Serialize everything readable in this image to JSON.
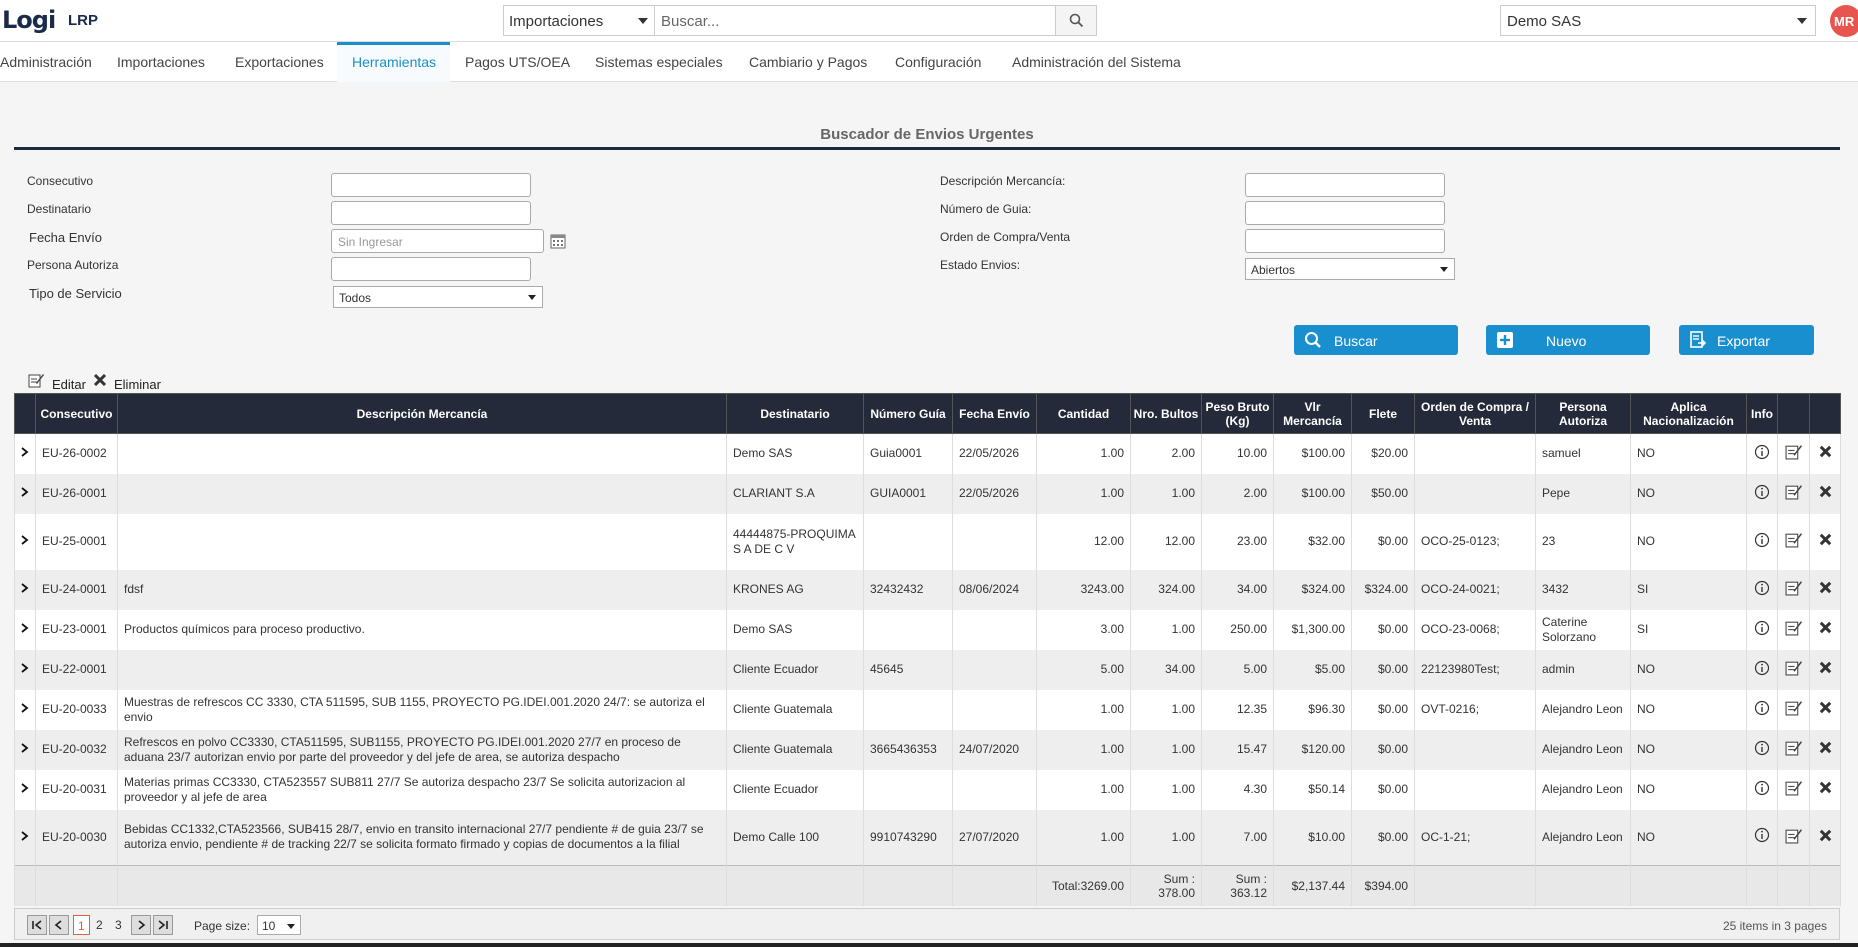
{
  "header": {
    "logo": "Logi",
    "logo_suffix": "LRP",
    "module_select": "Importaciones",
    "search_placeholder": "Buscar...",
    "company_select": "Demo SAS",
    "avatar_initials": "MR"
  },
  "nav": {
    "items": [
      {
        "label": "Administración"
      },
      {
        "label": "Importaciones"
      },
      {
        "label": "Exportaciones"
      },
      {
        "label": "Herramientas",
        "active": true
      },
      {
        "label": "Pagos UTS/OEA"
      },
      {
        "label": "Sistemas especiales"
      },
      {
        "label": "Cambiario y Pagos"
      },
      {
        "label": "Configuración"
      },
      {
        "label": "Administración del Sistema"
      }
    ]
  },
  "panel": {
    "title": "Buscador de Envios Urgentes"
  },
  "form": {
    "consecutivo": "Consecutivo",
    "destinatario": "Destinatario",
    "fecha_envio": "Fecha Envío",
    "fecha_placeholder": "Sin Ingresar",
    "persona_autoriza": "Persona Autoriza",
    "tipo_servicio": "Tipo de Servicio",
    "tipo_servicio_value": "Todos",
    "descripcion": "Descripción Mercancía:",
    "numero_guia": "Número de Guia:",
    "orden_compra": "Orden de Compra/Venta",
    "estado_envios": "Estado Envios:",
    "estado_value": "Abiertos"
  },
  "buttons": {
    "buscar": "Buscar",
    "nuevo": "Nuevo",
    "exportar": "Exportar"
  },
  "toolbar": {
    "editar": "Editar",
    "eliminar": "Eliminar"
  },
  "grid": {
    "columns": [
      "Consecutivo",
      "Descripción Mercancía",
      "Destinatario",
      "Número Guía",
      "Fecha Envío",
      "Cantidad",
      "Nro. Bultos",
      "Peso Bruto (Kg)",
      "Vlr Mercancía",
      "Flete",
      "Orden de Compra / Venta",
      "Persona Autoriza",
      "Aplica Nacionalización",
      "Info"
    ],
    "rows": [
      {
        "consecutivo": "EU-26-0002",
        "descripcion": "",
        "destinatario": "Demo SAS",
        "guia": "Guia0001",
        "fecha": "22/05/2026",
        "cantidad": "1.00",
        "bultos": "2.00",
        "peso": "10.00",
        "valor": "$100.00",
        "flete": "$20.00",
        "orden": "",
        "persona": "samuel",
        "aplica": "NO"
      },
      {
        "consecutivo": "EU-26-0001",
        "descripcion": "",
        "destinatario": "CLARIANT S.A",
        "guia": "GUIA0001",
        "fecha": "22/05/2026",
        "cantidad": "1.00",
        "bultos": "1.00",
        "peso": "2.00",
        "valor": "$100.00",
        "flete": "$50.00",
        "orden": "",
        "persona": "Pepe",
        "aplica": "NO"
      },
      {
        "consecutivo": "EU-25-0001",
        "descripcion": "",
        "destinatario": "44444875-PROQUIMA S A DE C V",
        "guia": "",
        "fecha": "",
        "cantidad": "12.00",
        "bultos": "12.00",
        "peso": "23.00",
        "valor": "$32.00",
        "flete": "$0.00",
        "orden": "OCO-25-0123;",
        "persona": "23",
        "aplica": "NO"
      },
      {
        "consecutivo": "EU-24-0001",
        "descripcion": "fdsf",
        "destinatario": "KRONES AG",
        "guia": "32432432",
        "fecha": "08/06/2024",
        "cantidad": "3243.00",
        "bultos": "324.00",
        "peso": "34.00",
        "valor": "$324.00",
        "flete": "$324.00",
        "orden": "OCO-24-0021;",
        "persona": "3432",
        "aplica": "SI"
      },
      {
        "consecutivo": "EU-23-0001",
        "descripcion": "Productos químicos para proceso productivo.",
        "destinatario": "Demo SAS",
        "guia": "",
        "fecha": "",
        "cantidad": "3.00",
        "bultos": "1.00",
        "peso": "250.00",
        "valor": "$1,300.00",
        "flete": "$0.00",
        "orden": "OCO-23-0068;",
        "persona": "Caterine Solorzano",
        "aplica": "SI"
      },
      {
        "consecutivo": "EU-22-0001",
        "descripcion": "",
        "destinatario": "Cliente Ecuador",
        "guia": "45645",
        "fecha": "",
        "cantidad": "5.00",
        "bultos": "34.00",
        "peso": "5.00",
        "valor": "$5.00",
        "flete": "$0.00",
        "orden": "22123980Test;",
        "persona": "admin",
        "aplica": "NO"
      },
      {
        "consecutivo": "EU-20-0033",
        "descripcion": "Muestras de refrescos CC 3330, CTA 511595, SUB 1155, PROYECTO PG.IDEI.001.2020 24/7: se autoriza el envio",
        "destinatario": "Cliente Guatemala",
        "guia": "",
        "fecha": "",
        "cantidad": "1.00",
        "bultos": "1.00",
        "peso": "12.35",
        "valor": "$96.30",
        "flete": "$0.00",
        "orden": "OVT-0216;",
        "persona": "Alejandro Leon",
        "aplica": "NO"
      },
      {
        "consecutivo": "EU-20-0032",
        "descripcion": "Refrescos en polvo CC3330, CTA511595, SUB1155, PROYECTO PG.IDEI.001.2020 27/7 en proceso de aduana 23/7 autorizan envio por parte del proveedor y del jefe de area, se autoriza despacho",
        "destinatario": "Cliente Guatemala",
        "guia": "3665436353",
        "fecha": "24/07/2020",
        "cantidad": "1.00",
        "bultos": "1.00",
        "peso": "15.47",
        "valor": "$120.00",
        "flete": "$0.00",
        "orden": "",
        "persona": "Alejandro Leon",
        "aplica": "NO"
      },
      {
        "consecutivo": "EU-20-0031",
        "descripcion": "Materias primas CC3330, CTA523557 SUB811 27/7 Se autoriza despacho 23/7 Se solicita autorizacion al proveedor y al jefe de area",
        "destinatario": "Cliente Ecuador",
        "guia": "",
        "fecha": "",
        "cantidad": "1.00",
        "bultos": "1.00",
        "peso": "4.30",
        "valor": "$50.14",
        "flete": "$0.00",
        "orden": "",
        "persona": "Alejandro Leon",
        "aplica": "NO"
      },
      {
        "consecutivo": "EU-20-0030",
        "descripcion": "Bebidas CC1332,CTA523566, SUB415 28/7, envio en transito internacional 27/7 pendiente # de guia 23/7 se autoriza envio, pendiente # de tracking 22/7 se solicita formato firmado y copias de documentos a la filial",
        "destinatario": "Demo Calle 100",
        "guia": "9910743290",
        "fecha": "27/07/2020",
        "cantidad": "1.00",
        "bultos": "1.00",
        "peso": "7.00",
        "valor": "$10.00",
        "flete": "$0.00",
        "orden": "OC-1-21;",
        "persona": "Alejandro Leon",
        "aplica": "NO"
      }
    ],
    "footer": {
      "cantidad": "Total:3269.00",
      "bultos": "Sum : 378.00",
      "peso": "Sum : 363.12",
      "valor": "$2,137.44",
      "flete": "$394.00"
    }
  },
  "pager": {
    "pages": [
      "1",
      "2",
      "3"
    ],
    "current": "1",
    "page_size_label": "Page size:",
    "page_size": "10",
    "items_info": "25 items in 3 pages"
  },
  "colors": {
    "accent": "#1a8fd0",
    "header_dark": "#252a3a",
    "avatar": "#e8544e"
  }
}
